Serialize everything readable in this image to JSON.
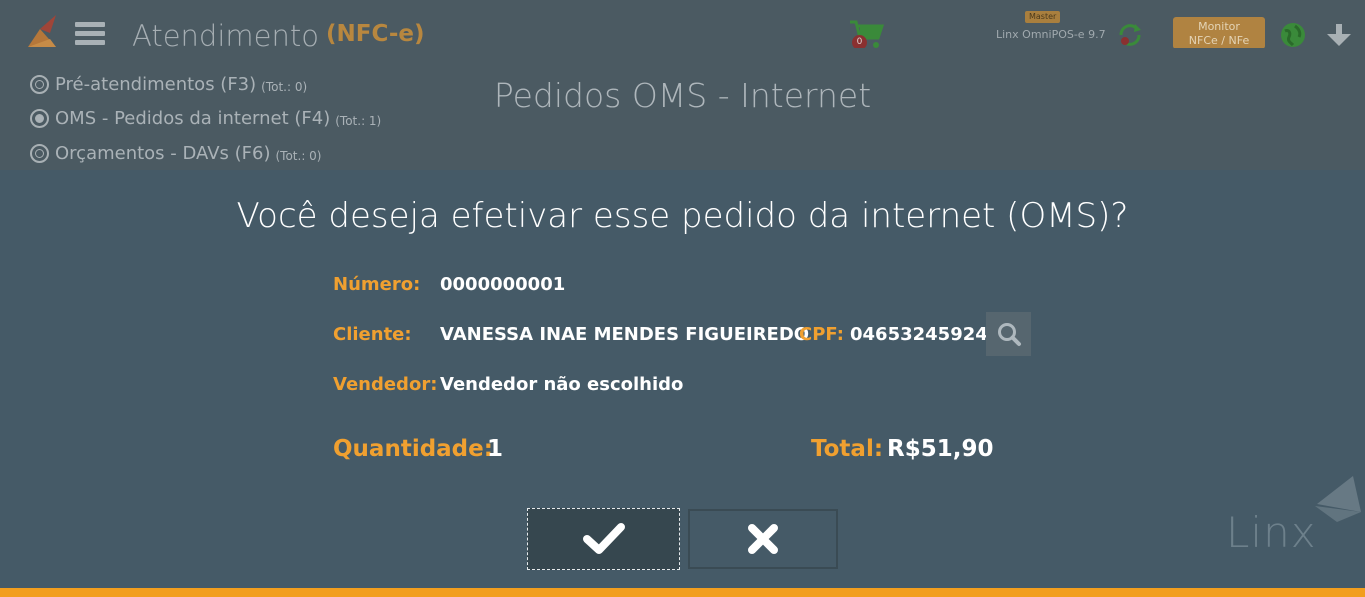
{
  "header": {
    "title": "Atendimento",
    "subtitle": "(NFC-e)",
    "cart_count": "0",
    "master_badge": "Master",
    "version": "Linx OmniPOS-e  9.7",
    "monitor_button": {
      "line1": "Monitor",
      "line2": "NFCe / NFe"
    }
  },
  "filters": [
    {
      "label": "Pré-atendimentos (F3)",
      "total": "(Tot.: 0)",
      "checked": false
    },
    {
      "label": "OMS - Pedidos da internet (F4)",
      "total": "(Tot.: 1)",
      "checked": true
    },
    {
      "label": "Orçamentos - DAVs (F6)",
      "total": "(Tot.: 0)",
      "checked": false
    }
  ],
  "page_heading": "Pedidos OMS - Internet",
  "modal": {
    "question": "Você deseja efetivar esse pedido da internet (OMS)?",
    "numero_label": "Número:",
    "numero_value": "0000000001",
    "cliente_label": "Cliente:",
    "cliente_value": "VANESSA INAE MENDES FIGUEIREDO",
    "cpf_label": "CPF:",
    "cpf_value": "04653245924",
    "vendedor_label": "Vendedor:",
    "vendedor_value": "Vendedor não escolhido",
    "quantidade_label": "Quantidade:",
    "quantidade_value": "1",
    "total_label": "Total:",
    "total_value": "R$51,90"
  },
  "watermark": "Linx",
  "colors": {
    "accent": "#f29e1e",
    "label": "#f0a030",
    "modal_bg": "#455a67",
    "backdrop": "#4b5a62"
  },
  "icons": [
    "logo-icon",
    "menu-icon",
    "cart-icon",
    "sync-icon",
    "globe-icon",
    "arrow-down-icon",
    "search-icon",
    "check-icon",
    "close-icon"
  ]
}
